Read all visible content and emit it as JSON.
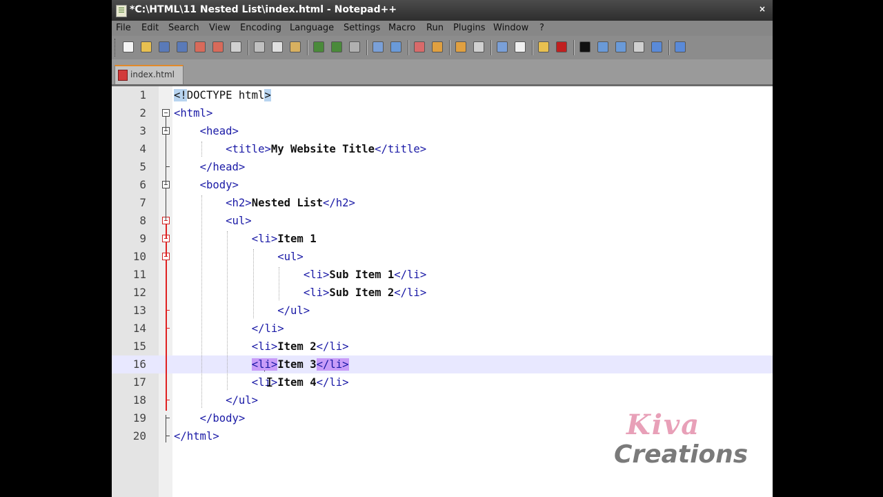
{
  "window": {
    "title": "*C:\\HTML\\11 Nested List\\index.html - Notepad++",
    "close_glyph": "×"
  },
  "menu": [
    "File",
    "Edit",
    "Search",
    "View",
    "Encoding",
    "Language",
    "Settings",
    "Macro",
    "Run",
    "Plugins",
    "Window",
    "?"
  ],
  "toolbar": {
    "buttons": [
      {
        "name": "new-file-icon",
        "color": "#f4f4f4"
      },
      {
        "name": "open-file-icon",
        "color": "#e8c050"
      },
      {
        "name": "save-icon",
        "color": "#5a7ab8"
      },
      {
        "name": "save-all-icon",
        "color": "#5a7ab8"
      },
      {
        "name": "close-icon",
        "color": "#d86a5a"
      },
      {
        "name": "close-all-icon",
        "color": "#d86a5a"
      },
      {
        "name": "print-icon",
        "color": "#d0d0d0"
      },
      {
        "name": "cut-icon",
        "color": "#c0c0c0"
      },
      {
        "name": "copy-icon",
        "color": "#e0e0e0"
      },
      {
        "name": "paste-icon",
        "color": "#d8b060"
      },
      {
        "name": "undo-icon",
        "color": "#4a8a3a"
      },
      {
        "name": "redo-icon",
        "color": "#4a8a3a"
      },
      {
        "name": "find-icon",
        "color": "#b0b0b0"
      },
      {
        "name": "replace-icon",
        "color": "#7aa0d8"
      },
      {
        "name": "zoom-in-icon",
        "color": "#6a9ad8"
      },
      {
        "name": "zoom-out-icon",
        "color": "#d86a6a"
      },
      {
        "name": "sync-vertical-icon",
        "color": "#e0a040"
      },
      {
        "name": "sync-horizontal-icon",
        "color": "#e0a040"
      },
      {
        "name": "word-wrap-icon",
        "color": "#d0d0d0"
      },
      {
        "name": "show-all-chars-icon",
        "color": "#7aa0d8"
      },
      {
        "name": "indent-guide-icon",
        "color": "#f0f0f0"
      },
      {
        "name": "user-lang-icon",
        "color": "#e8c050"
      },
      {
        "name": "record-macro-icon",
        "color": "#c02020"
      },
      {
        "name": "stop-record-icon",
        "color": "#111111"
      },
      {
        "name": "playback-macro-icon",
        "color": "#6a9ad8"
      },
      {
        "name": "run-macro-multiple-icon",
        "color": "#6a9ad8"
      },
      {
        "name": "save-macro-icon",
        "color": "#d0d0d0"
      },
      {
        "name": "spell-check-icon",
        "color": "#5a8ad8"
      },
      {
        "name": "more-icon",
        "color": "#5a8ad8"
      }
    ]
  },
  "tabs": [
    {
      "label": "index.html",
      "active": true
    }
  ],
  "editor": {
    "current_line": 16,
    "lines": [
      {
        "num": "1",
        "tokens": [
          {
            "t": "<!",
            "c": "doctype hl-blue"
          },
          {
            "t": "DOCTYPE html",
            "c": "doctype"
          },
          {
            "t": ">",
            "c": "doctype hl-blue"
          }
        ]
      },
      {
        "num": "2",
        "tokens": [
          {
            "t": "<html>",
            "c": "tag"
          }
        ]
      },
      {
        "num": "3",
        "tokens": [
          {
            "t": "<head>",
            "c": "tag"
          }
        ]
      },
      {
        "num": "4",
        "tokens": [
          {
            "t": "<title>",
            "c": "tag"
          },
          {
            "t": "My Website Title",
            "c": "txt"
          },
          {
            "t": "</title>",
            "c": "tag"
          }
        ]
      },
      {
        "num": "5",
        "tokens": [
          {
            "t": "</head>",
            "c": "tag"
          }
        ]
      },
      {
        "num": "6",
        "tokens": [
          {
            "t": "<body>",
            "c": "tag"
          }
        ]
      },
      {
        "num": "7",
        "tokens": [
          {
            "t": "<h2>",
            "c": "tag"
          },
          {
            "t": "Nested List",
            "c": "txt"
          },
          {
            "t": "</h2>",
            "c": "tag"
          }
        ]
      },
      {
        "num": "8",
        "tokens": [
          {
            "t": "<ul>",
            "c": "tag"
          }
        ]
      },
      {
        "num": "9",
        "tokens": [
          {
            "t": "<li>",
            "c": "tag"
          },
          {
            "t": "Item 1",
            "c": "txt"
          }
        ]
      },
      {
        "num": "10",
        "tokens": [
          {
            "t": "<ul>",
            "c": "tag"
          }
        ]
      },
      {
        "num": "11",
        "tokens": [
          {
            "t": "<li>",
            "c": "tag"
          },
          {
            "t": "Sub Item 1",
            "c": "txt"
          },
          {
            "t": "</li>",
            "c": "tag"
          }
        ]
      },
      {
        "num": "12",
        "tokens": [
          {
            "t": "<li>",
            "c": "tag"
          },
          {
            "t": "Sub Item 2",
            "c": "txt"
          },
          {
            "t": "</li>",
            "c": "tag"
          }
        ]
      },
      {
        "num": "13",
        "tokens": [
          {
            "t": "</ul>",
            "c": "tag"
          }
        ]
      },
      {
        "num": "14",
        "tokens": [
          {
            "t": "</li>",
            "c": "tag"
          }
        ]
      },
      {
        "num": "15",
        "tokens": [
          {
            "t": "<li>",
            "c": "tag"
          },
          {
            "t": "Item 2",
            "c": "txt"
          },
          {
            "t": "</li>",
            "c": "tag"
          }
        ]
      },
      {
        "num": "16",
        "tokens": [
          {
            "t": "<l",
            "c": "tag hl-purple"
          },
          {
            "t": "|",
            "c": "caret"
          },
          {
            "t": "i>",
            "c": "tag hl-purple"
          },
          {
            "t": "Item 3",
            "c": "txt"
          },
          {
            "t": "</li>",
            "c": "tag hl-purple"
          }
        ]
      },
      {
        "num": "17",
        "tokens": [
          {
            "t": "<li>",
            "c": "tag"
          },
          {
            "t": "Item 4",
            "c": "txt"
          },
          {
            "t": "</li>",
            "c": "tag"
          }
        ]
      },
      {
        "num": "18",
        "tokens": [
          {
            "t": "</ul>",
            "c": "tag"
          }
        ]
      },
      {
        "num": "19",
        "tokens": [
          {
            "t": "</body>",
            "c": "tag"
          }
        ]
      },
      {
        "num": "20",
        "tokens": [
          {
            "t": "</html>",
            "c": "tag"
          }
        ]
      }
    ]
  },
  "watermark": {
    "line1": "Kiva",
    "line2": "Creations"
  }
}
